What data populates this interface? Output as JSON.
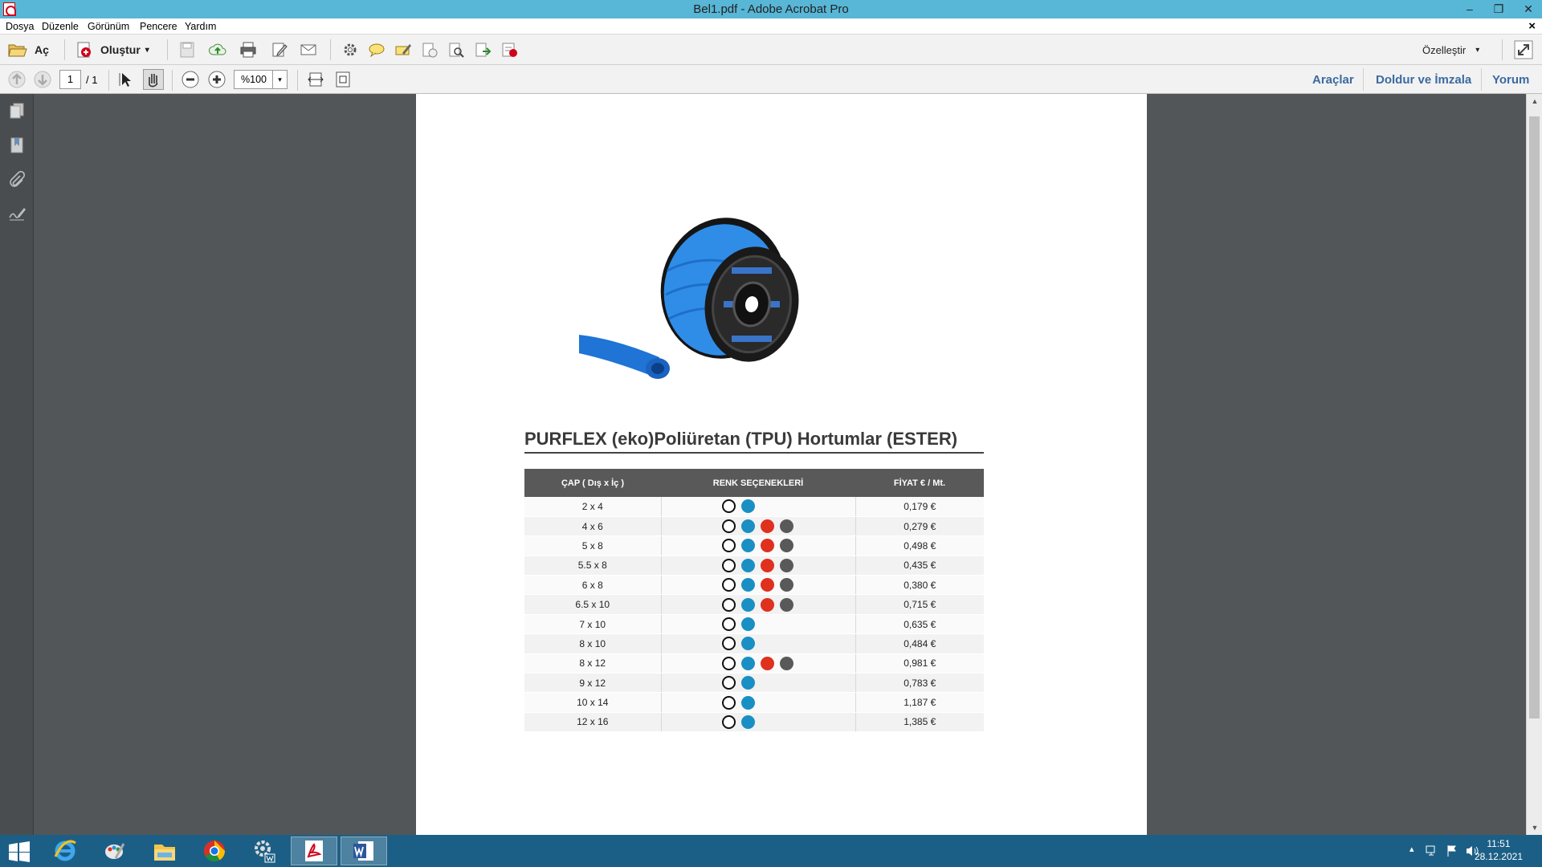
{
  "window": {
    "title": "Bel1.pdf - Adobe Acrobat Pro",
    "minimize_glyph": "–",
    "restore_glyph": "❐",
    "close_glyph": "✕"
  },
  "menu": {
    "items": [
      "Dosya",
      "Düzenle",
      "Görünüm",
      "Pencere",
      "Yardım"
    ],
    "doc_close": "×"
  },
  "toolbar": {
    "open_label": "Aç",
    "create_label": "Oluştur",
    "customize_label": "Özelleştir",
    "dropdown_glyph": "▾"
  },
  "navbar": {
    "page_current": "1",
    "page_total": "/ 1",
    "zoom_value": "%100",
    "tools_label": "Araçlar",
    "fill_sign_label": "Doldur ve İmzala",
    "comment_label": "Yorum"
  },
  "document": {
    "title": "PURFLEX (eko)Poliüretan (TPU) Hortumlar (ESTER)",
    "table": {
      "headers": [
        "ÇAP ( Dış x İç )",
        "RENK SEÇENEKLERİ",
        "FİYAT   € / Mt."
      ],
      "rows": [
        {
          "size": "2 x 4",
          "colors": [
            "white",
            "blue"
          ],
          "price": "0,179 €"
        },
        {
          "size": "4 x 6",
          "colors": [
            "white",
            "blue",
            "red",
            "gray"
          ],
          "price": "0,279 €"
        },
        {
          "size": "5 x 8",
          "colors": [
            "white",
            "blue",
            "red",
            "gray"
          ],
          "price": "0,498 €"
        },
        {
          "size": "5.5 x 8",
          "colors": [
            "white",
            "blue",
            "red",
            "gray"
          ],
          "price": "0,435 €"
        },
        {
          "size": "6 x 8",
          "colors": [
            "white",
            "blue",
            "red",
            "gray"
          ],
          "price": "0,380 €"
        },
        {
          "size": "6.5 x 10",
          "colors": [
            "white",
            "blue",
            "red",
            "gray"
          ],
          "price": "0,715 €"
        },
        {
          "size": "7 x 10",
          "colors": [
            "white",
            "blue"
          ],
          "price": "0,635 €"
        },
        {
          "size": "8 x 10",
          "colors": [
            "white",
            "blue"
          ],
          "price": "0,484 €"
        },
        {
          "size": "8 x 12",
          "colors": [
            "white",
            "blue",
            "red",
            "gray"
          ],
          "price": "0,981 €"
        },
        {
          "size": "9 x 12",
          "colors": [
            "white",
            "blue"
          ],
          "price": "0,783 €"
        },
        {
          "size": "10 x 14",
          "colors": [
            "white",
            "blue"
          ],
          "price": "1,187 €"
        },
        {
          "size": "12 x 16",
          "colors": [
            "white",
            "blue"
          ],
          "price": "1,385 €"
        }
      ]
    },
    "dot_colors": {
      "white": "#ffffff",
      "blue": "#1a8fc3",
      "red": "#e0301e",
      "gray": "#595959"
    }
  },
  "taskbar": {
    "apps": [
      "start-icon",
      "internet-explorer-icon",
      "paint-icon",
      "file-explorer-icon",
      "chrome-icon",
      "settings-app-icon",
      "acrobat-icon",
      "word-icon"
    ],
    "clock_time": "11:51",
    "clock_date": "28.12.2021",
    "tray_up_glyph": "▴"
  },
  "colors": {
    "titlebar": "#58b6d6",
    "taskbar": "#1c5f86",
    "link": "#3b6aa0",
    "table_header": "#595959"
  }
}
